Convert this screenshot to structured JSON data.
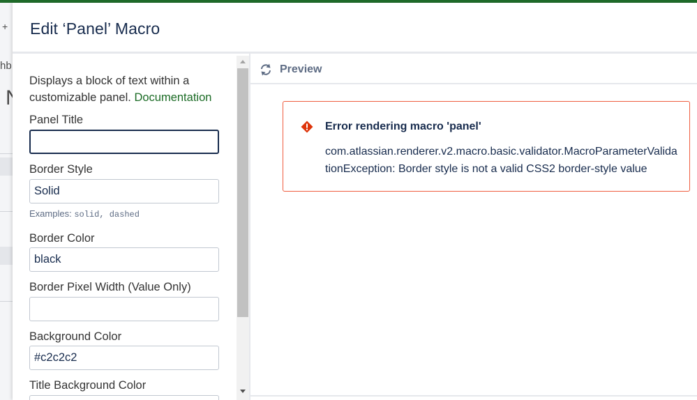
{
  "background": {
    "fragment_top": "+",
    "fragment_mid": "hb",
    "fragment_big": "N"
  },
  "dialog": {
    "title": "Edit ‘Panel’ Macro"
  },
  "form": {
    "description": "Displays a block of text within a customizable panel.",
    "documentation_link": "Documentation",
    "fields": [
      {
        "label": "Panel Title",
        "value": "",
        "focused": true
      },
      {
        "label": "Border Style",
        "value": "Solid",
        "hint_prefix": "Examples: ",
        "hint_code": "solid, dashed"
      },
      {
        "label": "Border Color",
        "value": "black"
      },
      {
        "label": "Border Pixel Width (Value Only)",
        "value": ""
      },
      {
        "label": "Background Color",
        "value": "#c2c2c2"
      },
      {
        "label": "Title Background Color",
        "value": ""
      }
    ]
  },
  "preview": {
    "label": "Preview",
    "icon": "refresh-icon",
    "error": {
      "icon": "error-icon",
      "title": "Error rendering macro 'panel'",
      "message": "com.atlassian.renderer.v2.macro.basic.validator.MacroParameterValidationException: Border style is not a valid CSS2 border-style value"
    }
  },
  "colors": {
    "accent_link": "#1b6b25",
    "error_border": "#ef5c3e",
    "error_icon": "#de350b",
    "top_bar": "#1f6b2a"
  }
}
